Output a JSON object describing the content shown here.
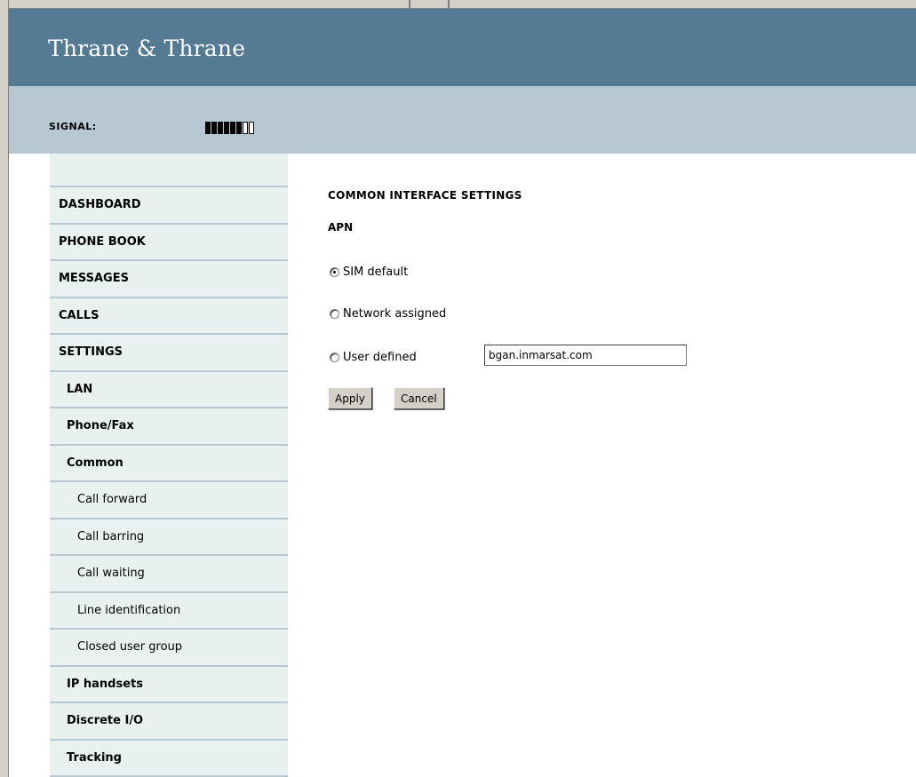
{
  "header": {
    "brand": "Thrane & Thrane",
    "signal_label": "SIGNAL:",
    "signal_strength": {
      "filled": 6,
      "total": 8
    }
  },
  "sidebar": {
    "items": [
      {
        "label": "DASHBOARD",
        "level": 0
      },
      {
        "label": "PHONE BOOK",
        "level": 0
      },
      {
        "label": "MESSAGES",
        "level": 0
      },
      {
        "label": "CALLS",
        "level": 0
      },
      {
        "label": "SETTINGS",
        "level": 0
      },
      {
        "label": "LAN",
        "level": 1
      },
      {
        "label": "Phone/Fax",
        "level": 1
      },
      {
        "label": "Common",
        "level": 1
      },
      {
        "label": "Call forward",
        "level": 2
      },
      {
        "label": "Call barring",
        "level": 2
      },
      {
        "label": "Call waiting",
        "level": 2
      },
      {
        "label": "Line identification",
        "level": 2
      },
      {
        "label": "Closed user group",
        "level": 2
      },
      {
        "label": "IP handsets",
        "level": 1
      },
      {
        "label": "Discrete I/O",
        "level": 1
      },
      {
        "label": "Tracking",
        "level": 1
      }
    ]
  },
  "main": {
    "title": "COMMON INTERFACE SETTINGS",
    "section": "APN",
    "options": {
      "sim_default": "SIM default",
      "network_assigned": "Network assigned",
      "user_defined": "User defined"
    },
    "selected_option": "SIM default",
    "user_defined_value": "bgan.inmarsat.com",
    "apply_label": "Apply",
    "cancel_label": "Cancel"
  },
  "colors": {
    "brand_bar": "#557a93",
    "signal_bar": "#b8c8d3",
    "sidebar_bg": "#e9f0f0"
  }
}
